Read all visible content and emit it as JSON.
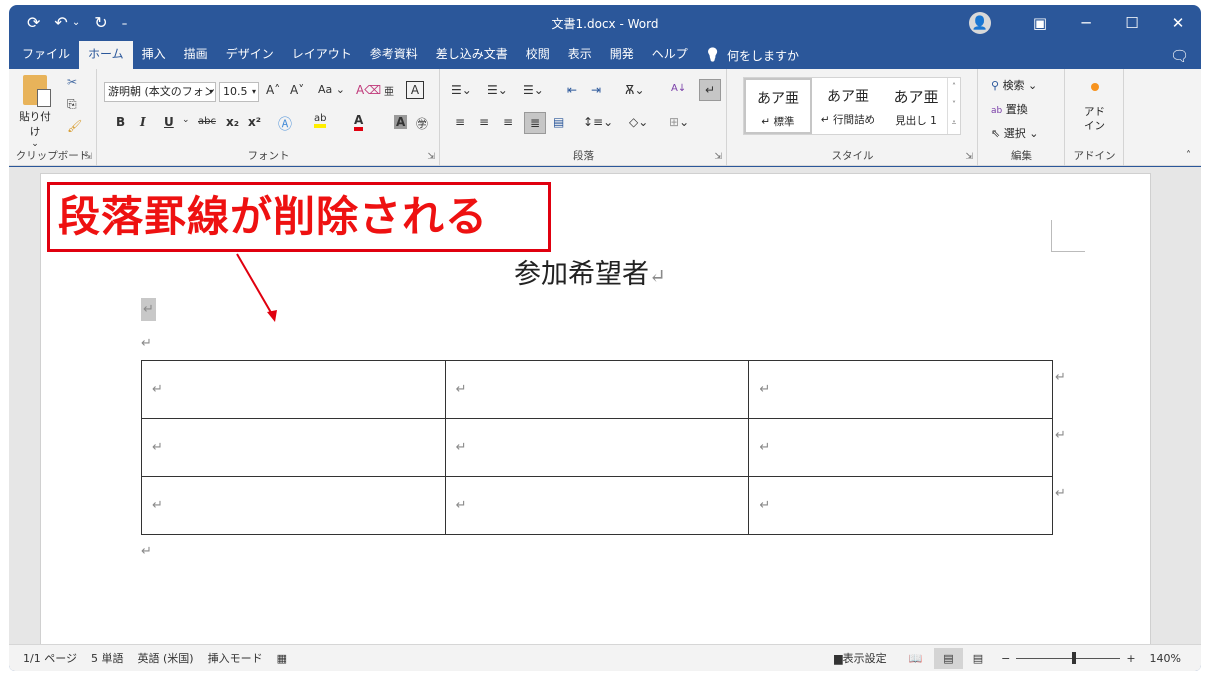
{
  "titlebar": {
    "title": "文書1.docx  -  Word",
    "qat": [
      {
        "icon": "autosave-icon",
        "glyph": "⟳"
      },
      {
        "icon": "undo-icon",
        "glyph": "↶"
      },
      {
        "icon": "undo-dropdown-icon",
        "glyph": "⌄"
      },
      {
        "icon": "redo-icon",
        "glyph": "↻"
      },
      {
        "icon": "customize-qat-icon",
        "glyph": "₌"
      }
    ],
    "controls": {
      "account": "👤",
      "ribbon_display": "▣",
      "minimize": "─",
      "maximize": "☐",
      "close": "✕"
    }
  },
  "tabs": [
    {
      "label": "ファイル",
      "active": false
    },
    {
      "label": "ホーム",
      "active": true
    },
    {
      "label": "挿入",
      "active": false
    },
    {
      "label": "描画",
      "active": false
    },
    {
      "label": "デザイン",
      "active": false
    },
    {
      "label": "レイアウト",
      "active": false
    },
    {
      "label": "参考資料",
      "active": false
    },
    {
      "label": "差し込み文書",
      "active": false
    },
    {
      "label": "校閲",
      "active": false
    },
    {
      "label": "表示",
      "active": false
    },
    {
      "label": "開発",
      "active": false
    },
    {
      "label": "ヘルプ",
      "active": false
    }
  ],
  "tellme": {
    "label": "何をしますか",
    "icon": "💡"
  },
  "ribbon": {
    "clipboard": {
      "label": "クリップボード",
      "paste": "貼り付け"
    },
    "font": {
      "label": "フォント",
      "font_name": "游明朝 (本文のフォン",
      "font_size": "10.5"
    },
    "paragraph": {
      "label": "段落"
    },
    "styles": {
      "label": "スタイル",
      "items": [
        {
          "preview": "あア亜",
          "name": "↵ 標準"
        },
        {
          "preview": "あア亜",
          "name": "↵ 行間詰め"
        },
        {
          "preview": "あア亜",
          "name": "見出し 1"
        }
      ]
    },
    "editing": {
      "label": "編集",
      "find": "検索",
      "replace": "置換",
      "select": "選択"
    },
    "addins": {
      "label": "アドイン",
      "button": "アド\nイン"
    }
  },
  "document": {
    "callout": "段落罫線が削除される",
    "heading": "参加希望者",
    "pilcrow": "↵",
    "table": {
      "rows": 3,
      "cols": 3,
      "cells": [
        [
          "↵",
          "↵",
          "↵"
        ],
        [
          "↵",
          "↵",
          "↵"
        ],
        [
          "↵",
          "↵",
          "↵"
        ]
      ]
    }
  },
  "status": {
    "page": "1/1 ページ",
    "words": "5 単語",
    "language": "英語 (米国)",
    "mode": "挿入モード",
    "display_settings": "表示設定",
    "zoom_level": "140%",
    "zoom_percent": 140
  },
  "colors": {
    "accent": "#2b579a",
    "callout_red": "#e0000f"
  }
}
